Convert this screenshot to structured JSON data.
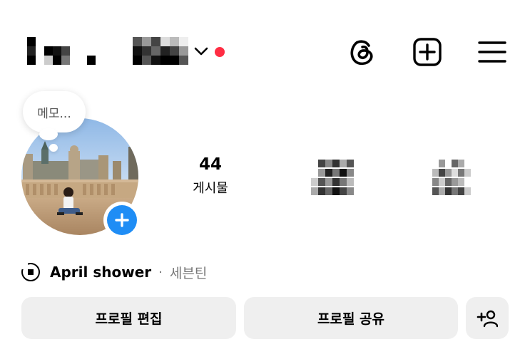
{
  "header": {
    "username": "",
    "status_dot_color": "#ff2d43",
    "icons": [
      "threads-icon",
      "add-post-icon",
      "menu-icon"
    ]
  },
  "memo": {
    "placeholder": "메모..."
  },
  "stats": {
    "posts": {
      "count": "44",
      "label": "게시물"
    },
    "followers": {
      "count": "",
      "label": ""
    },
    "following": {
      "count": "",
      "label": ""
    }
  },
  "music": {
    "title": "April shower",
    "separator": "·",
    "artist": "세븐틴"
  },
  "actions": {
    "edit_profile": "프로필 편집",
    "share_profile": "프로필 공유"
  },
  "colors": {
    "accent": "#1f8df5",
    "button_bg": "#efefef"
  }
}
